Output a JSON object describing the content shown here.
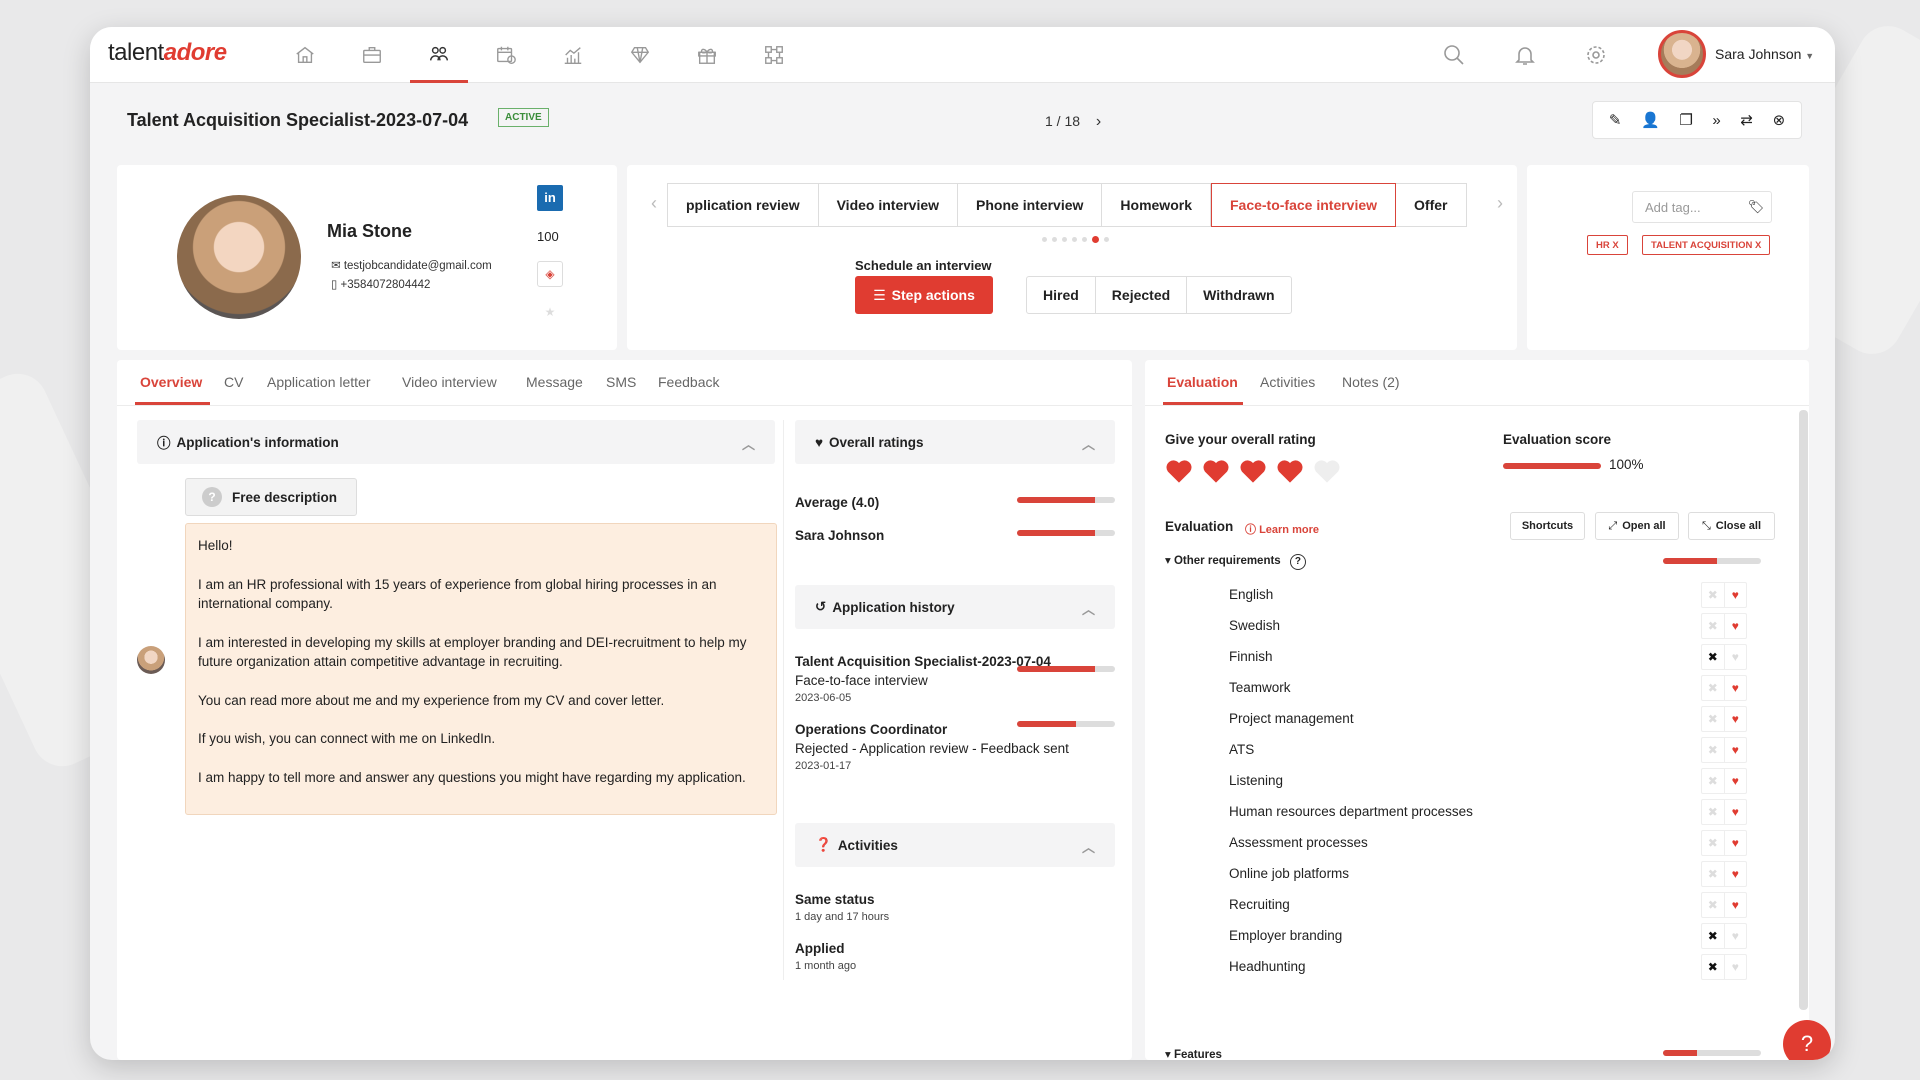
{
  "app": {
    "logo_text": "talent",
    "logo_accent": "adore",
    "brand_color": "#e03c31"
  },
  "nav": {
    "icons": [
      "home-icon",
      "briefcase-icon",
      "candidates-icon",
      "calendar-icon",
      "analytics-icon",
      "diamond-icon",
      "gift-icon",
      "integrations-icon"
    ],
    "active_index": 2
  },
  "user": {
    "name": "Sara Johnson"
  },
  "job": {
    "title": "Talent Acquisition Specialist-2023-07-04",
    "status": "ACTIVE",
    "pager": "1 / 18"
  },
  "candidate": {
    "name": "Mia Stone",
    "email": "testjobcandidate@gmail.com",
    "phone": "+3584072804442",
    "score": "100",
    "linkedin": "in"
  },
  "steps": {
    "items": [
      "pplication review",
      "Video interview",
      "Phone interview",
      "Homework",
      "Face-to-face interview",
      "Offer"
    ],
    "current_index": 4,
    "schedule_label": "Schedule an interview",
    "step_actions": "Step actions",
    "buttons": [
      "Hired",
      "Rejected",
      "Withdrawn"
    ]
  },
  "tags": {
    "placeholder": "Add tag...",
    "items": [
      "HR X",
      "TALENT ACQUISITION X"
    ]
  },
  "left_tabs": {
    "items": [
      "Overview",
      "CV",
      "Application letter",
      "Video interview",
      "Message",
      "SMS",
      "Feedback"
    ],
    "active_index": 0
  },
  "app_info": {
    "title": "Application's information",
    "free_description": "Free description",
    "letter": [
      "Hello!",
      "I am an HR professional with 15 years of experience from global hiring processes in an international company.",
      "I am interested in developing my skills at employer branding and DEI-recruitment to help my future organization attain competitive advantage in recruiting.",
      "You can read more about me and my experience from my CV and cover letter.",
      "If you wish, you can connect with me on LinkedIn.",
      "I am happy to tell more and answer any questions you might have regarding my application."
    ]
  },
  "ratings": {
    "title": "Overall ratings",
    "rows": [
      {
        "label": "Average (4.0)",
        "value": 0.8
      },
      {
        "label": "Sara Johnson",
        "value": 0.8
      }
    ]
  },
  "history": {
    "title": "Application history",
    "items": [
      {
        "title": "Talent Acquisition Specialist-2023-07-04",
        "status": "Face-to-face interview",
        "date": "2023-06-05",
        "value": 0.8
      },
      {
        "title": "Operations Coordinator",
        "status": "Rejected - Application review - Feedback sent",
        "date": "2023-01-17",
        "value": 0.6
      }
    ]
  },
  "activities": {
    "title": "Activities",
    "items": [
      {
        "title": "Same status",
        "sub": "1 day and 17 hours"
      },
      {
        "title": "Applied",
        "sub": "1 month ago"
      }
    ]
  },
  "right_tabs": {
    "items": [
      "Evaluation",
      "Activities",
      "Notes (2)"
    ],
    "active_index": 0
  },
  "evaluation": {
    "give_rating": "Give your overall rating",
    "rating_hearts": 4,
    "rating_max": 5,
    "score_label": "Evaluation score",
    "score_value": "100%",
    "score_fill": 1.0,
    "section_title": "Evaluation",
    "learn_more": "Learn more",
    "shortcuts": "Shortcuts",
    "open_all": "Open all",
    "close_all": "Close all",
    "group1": {
      "title": "Other requirements",
      "value": 0.55
    },
    "requirements": [
      {
        "label": "English",
        "state": "like"
      },
      {
        "label": "Swedish",
        "state": "like"
      },
      {
        "label": "Finnish",
        "state": "dislike"
      },
      {
        "label": "Teamwork",
        "state": "like"
      },
      {
        "label": "Project management",
        "state": "like"
      },
      {
        "label": "ATS",
        "state": "like"
      },
      {
        "label": "Listening",
        "state": "like"
      },
      {
        "label": "Human resources department processes",
        "state": "like"
      },
      {
        "label": "Assessment processes",
        "state": "like"
      },
      {
        "label": "Online job platforms",
        "state": "like"
      },
      {
        "label": "Recruiting",
        "state": "like"
      },
      {
        "label": "Employer branding",
        "state": "dislike"
      },
      {
        "label": "Headhunting",
        "state": "dislike"
      }
    ],
    "group2": {
      "title": "Features",
      "value": 0.35
    }
  }
}
